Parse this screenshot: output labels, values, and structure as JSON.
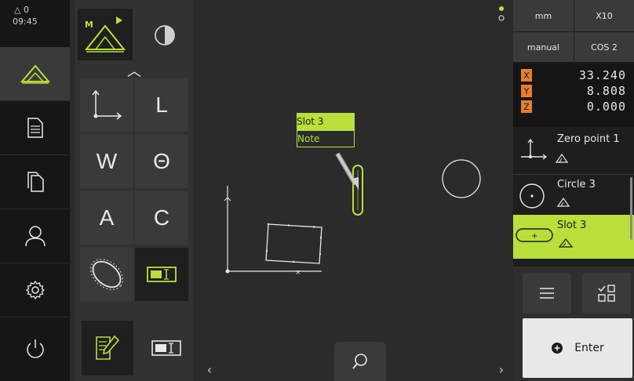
{
  "status": {
    "warning_count": "0",
    "time": "09:45"
  },
  "palette": {
    "labels": {
      "L": "L",
      "W": "W",
      "theta": "Θ",
      "A": "A",
      "C": "C"
    }
  },
  "canvas": {
    "tag": {
      "title": "Slot 3",
      "note": "Note"
    }
  },
  "right_panel": {
    "unit": "mm",
    "magnification": "X10",
    "mode": "manual",
    "coord_system": "COS 2",
    "coords": [
      {
        "axis": "X",
        "value": "33.240"
      },
      {
        "axis": "Y",
        "value": "8.808"
      },
      {
        "axis": "Z",
        "value": "0.000"
      }
    ],
    "features": [
      {
        "label": "Zero point 1"
      },
      {
        "label": "Circle 3"
      },
      {
        "label": "Slot 3"
      }
    ],
    "enter_label": "Enter"
  },
  "colors": {
    "accent": "#b9e03a",
    "axis_badge": "#e87e2c",
    "bg": "#2b2b2b",
    "sidebar": "#161616"
  }
}
